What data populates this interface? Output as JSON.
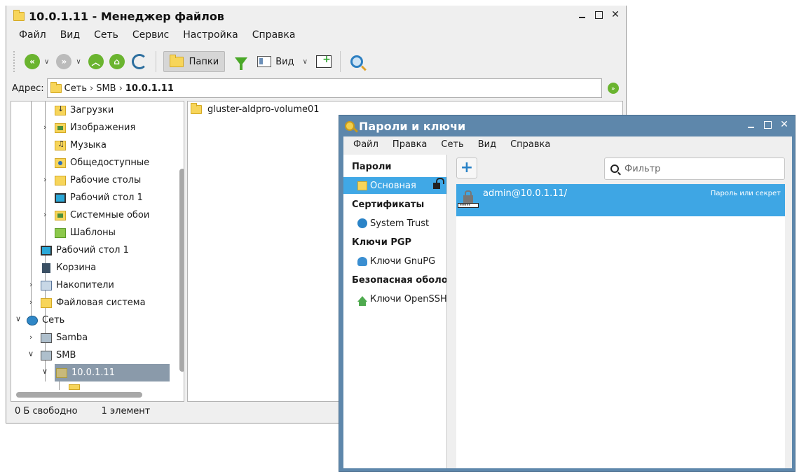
{
  "file_manager": {
    "title": "10.0.1.11 - Менеджер файлов",
    "menu": [
      "Файл",
      "Вид",
      "Сеть",
      "Сервис",
      "Настройка",
      "Справка"
    ],
    "toolbar": {
      "folders_label": "Папки",
      "view_label": "Вид",
      "icons": [
        "back-icon",
        "forward-icon",
        "up-icon",
        "home-icon",
        "refresh-icon",
        "filter-icon",
        "view-icon",
        "panel-add-icon",
        "search-icon"
      ]
    },
    "address": {
      "label": "Адрес:",
      "crumbs": [
        "Сеть",
        "SMB"
      ],
      "current": "10.0.1.11"
    },
    "tree": [
      {
        "label": "Загрузки",
        "icon": "downloads-folder-icon"
      },
      {
        "label": "Изображения",
        "icon": "pictures-folder-icon"
      },
      {
        "label": "Музыка",
        "icon": "music-folder-icon"
      },
      {
        "label": "Общедоступные",
        "icon": "public-folder-icon"
      },
      {
        "label": "Рабочие столы",
        "icon": "folder-icon"
      },
      {
        "label": "Рабочий стол 1",
        "icon": "desktop-icon"
      },
      {
        "label": "Системные обои",
        "icon": "wallpapers-folder-icon"
      },
      {
        "label": "Шаблоны",
        "icon": "templates-folder-icon"
      },
      {
        "label": "Рабочий стол 1",
        "icon": "desktop-icon"
      },
      {
        "label": "Корзина",
        "icon": "trash-icon"
      },
      {
        "label": "Накопители",
        "icon": "drives-icon"
      },
      {
        "label": "Файловая система",
        "icon": "folder-icon"
      },
      {
        "label": "Сеть",
        "icon": "network-icon"
      },
      {
        "label": "Samba",
        "icon": "server-icon"
      },
      {
        "label": "SMB",
        "icon": "server-icon"
      },
      {
        "label": "10.0.1.11",
        "icon": "folder-icon",
        "selected": true
      }
    ],
    "content": [
      {
        "label": "gluster-aldpro-volume01",
        "icon": "folder-icon"
      }
    ],
    "status": {
      "free": "0 Б свободно",
      "count": "1 элемент"
    }
  },
  "passwords_window": {
    "title": "Пароли и ключи",
    "menu": [
      "Файл",
      "Правка",
      "Сеть",
      "Вид",
      "Справка"
    ],
    "sidebar": {
      "passwords_header": "Пароли",
      "passwords_item": "Основная",
      "certs_header": "Сертификаты",
      "certs_item": "System Trust",
      "pgp_header": "Ключи PGP",
      "pgp_item": "Ключи GnuPG",
      "ssh_header": "Безопасная оболочка",
      "ssh_item": "Ключи OpenSSH"
    },
    "filter_placeholder": "Фильтр",
    "add_label": "+",
    "items": [
      {
        "name": "admin@10.0.1.11/",
        "kind": "Пароль или секрет",
        "selected": true
      }
    ]
  },
  "colors": {
    "selection_blue": "#3ea6e4",
    "pk_frame": "#5e87ab",
    "tree_selection": "#8a9aaa",
    "accent_green": "#6ab42f"
  }
}
